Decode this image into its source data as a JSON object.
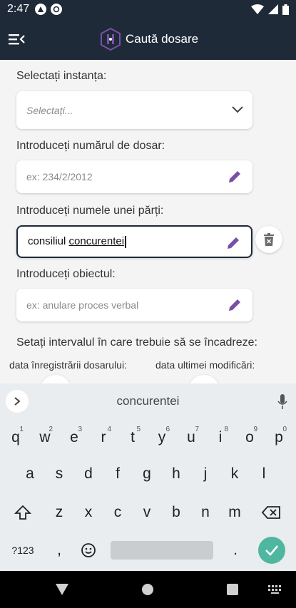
{
  "status_bar": {
    "time": "2:47"
  },
  "app_bar": {
    "title": "Caută dosare"
  },
  "form": {
    "court_label": "Selectați instanța:",
    "court_placeholder": "Selectați...",
    "case_number_label": "Introduceți numărul de dosar:",
    "case_number_placeholder": "ex: 234/2/2012",
    "party_label": "Introduceți numele unei părți:",
    "party_value_prefix": "consiliul ",
    "party_value_word": "concurentei",
    "object_label": "Introduceți obiectul:",
    "object_placeholder": "ex: anulare proces verbal",
    "interval_label": "Setați intervalul în care trebuie să se încadreze:",
    "registration_date_label": "data înregistrării dosarului:",
    "modification_date_label": "data ultimei modificări:"
  },
  "keyboard": {
    "suggestion": "concurentei",
    "row1": [
      {
        "k": "q",
        "n": "1"
      },
      {
        "k": "w",
        "n": "2"
      },
      {
        "k": "e",
        "n": "3"
      },
      {
        "k": "r",
        "n": "4"
      },
      {
        "k": "t",
        "n": "5"
      },
      {
        "k": "y",
        "n": "6"
      },
      {
        "k": "u",
        "n": "7"
      },
      {
        "k": "i",
        "n": "8"
      },
      {
        "k": "o",
        "n": "9"
      },
      {
        "k": "p",
        "n": "0"
      }
    ],
    "row2": [
      "a",
      "s",
      "d",
      "f",
      "g",
      "h",
      "j",
      "k",
      "l"
    ],
    "row3": [
      "z",
      "x",
      "c",
      "v",
      "b",
      "n",
      "m"
    ],
    "symbols_key": "?123",
    "comma_key": ",",
    "period_key": "."
  },
  "colors": {
    "app_bar": "#1e2a38",
    "accent_purple": "#7b4fa6",
    "enter_key": "#4fb7a0",
    "delete_icon": "#6b6b6b"
  }
}
